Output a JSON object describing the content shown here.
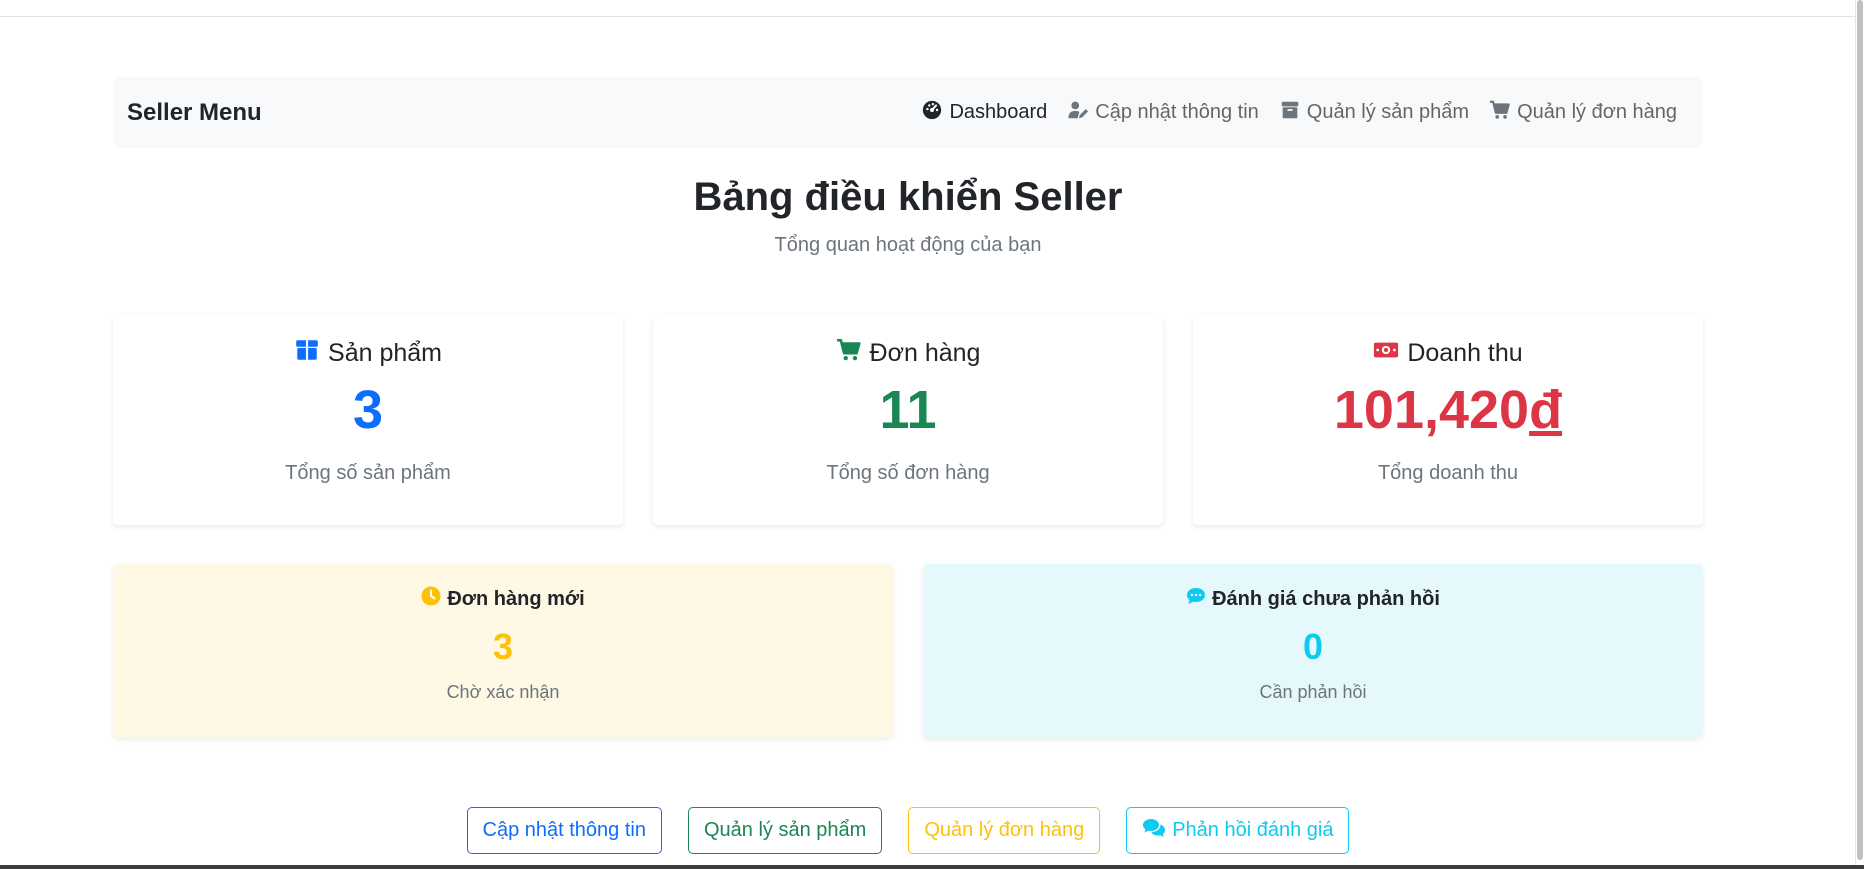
{
  "navbar": {
    "brand": "Seller Menu",
    "links": [
      {
        "label": "Dashboard",
        "icon": "dashboard-icon"
      },
      {
        "label": "Cập nhật thông tin",
        "icon": "user-edit-icon"
      },
      {
        "label": "Quản lý sản phẩm",
        "icon": "box-icon"
      },
      {
        "label": "Quản lý đơn hàng",
        "icon": "cart-icon"
      }
    ]
  },
  "header": {
    "title": "Bảng điều khiển Seller",
    "subtitle": "Tổng quan hoạt động của bạn"
  },
  "stats": [
    {
      "title": "Sản phẩm",
      "value": "3",
      "label": "Tổng số sản phẩm",
      "icon": "box-icon",
      "color": "#0d6efd"
    },
    {
      "title": "Đơn hàng",
      "value": "11",
      "label": "Tổng số đơn hàng",
      "icon": "cart-icon",
      "color": "#198754"
    },
    {
      "title": "Doanh thu",
      "value": "101,420",
      "currency": "đ",
      "label": "Tổng doanh thu",
      "icon": "money-icon",
      "color": "#dc3545"
    }
  ],
  "alerts": [
    {
      "title": "Đơn hàng mới",
      "value": "3",
      "label": "Chờ xác nhận",
      "icon": "clock-icon",
      "color": "#ffc107",
      "bg": "#fff8e5"
    },
    {
      "title": "Đánh giá chưa phản hồi",
      "value": "0",
      "label": "Cần phản hồi",
      "icon": "comment-icon",
      "color": "#0dcaf0",
      "bg": "#e5f8fb"
    }
  ],
  "actions": [
    {
      "label": "Cập nhật thông tin",
      "color": "#0d6efd"
    },
    {
      "label": "Quản lý sản phẩm",
      "color": "#198754"
    },
    {
      "label": "Quản lý đơn hàng",
      "color": "#ffc107"
    },
    {
      "label": "Phản hồi đánh giá",
      "color": "#0dcaf0",
      "icon": "comments-icon"
    }
  ]
}
